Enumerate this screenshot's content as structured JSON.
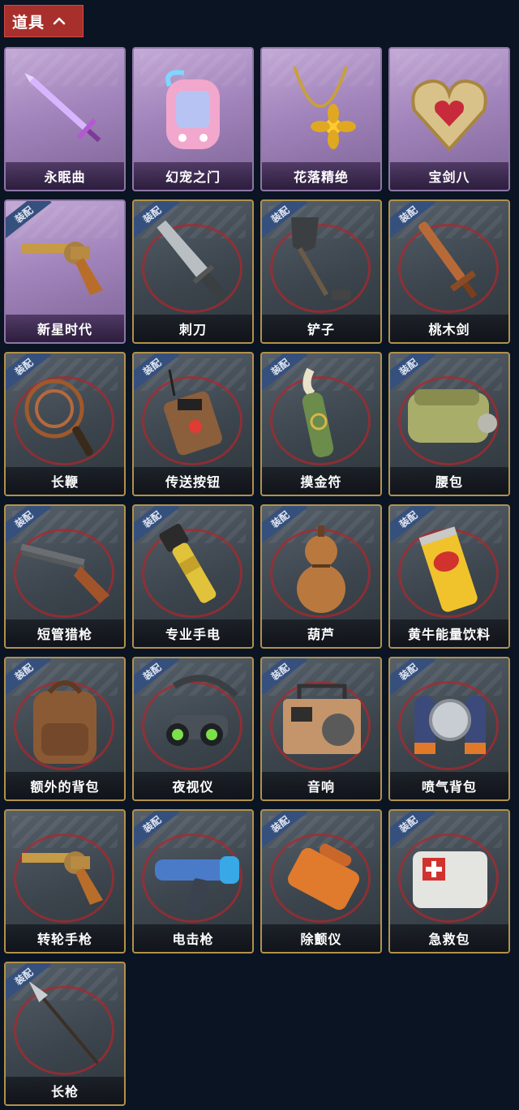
{
  "section": {
    "title": "道具",
    "toggle_icon": "chevron-up-icon"
  },
  "badge_text": "装配",
  "colors": {
    "header": "#a8302c",
    "badge": "#36507e",
    "frame": "#b2914a",
    "ring": "#aa282e",
    "background": "#0b1422"
  },
  "items": [
    {
      "name": "永眠曲",
      "icon": "sword-icon",
      "rarity": "purple",
      "equipped": false
    },
    {
      "name": "幻宠之门",
      "icon": "pet-device-icon",
      "rarity": "purple",
      "equipped": false
    },
    {
      "name": "花落精绝",
      "icon": "flower-necklace-icon",
      "rarity": "purple",
      "equipped": false
    },
    {
      "name": "宝剑八",
      "icon": "heart-amulet-icon",
      "rarity": "purple",
      "equipped": false
    },
    {
      "name": "新星时代",
      "icon": "revolver-icon",
      "rarity": "purple",
      "equipped": true
    },
    {
      "name": "刺刀",
      "icon": "bayonet-icon",
      "rarity": "normal",
      "equipped": true
    },
    {
      "name": "铲子",
      "icon": "shovel-icon",
      "rarity": "normal",
      "equipped": true
    },
    {
      "name": "桃木剑",
      "icon": "wooden-sword-icon",
      "rarity": "normal",
      "equipped": true
    },
    {
      "name": "长鞭",
      "icon": "whip-icon",
      "rarity": "normal",
      "equipped": true
    },
    {
      "name": "传送按钮",
      "icon": "teleport-remote-icon",
      "rarity": "normal",
      "equipped": true
    },
    {
      "name": "摸金符",
      "icon": "talisman-icon",
      "rarity": "normal",
      "equipped": true
    },
    {
      "name": "腰包",
      "icon": "waist-bag-icon",
      "rarity": "normal",
      "equipped": true
    },
    {
      "name": "短管猎枪",
      "icon": "shotgun-icon",
      "rarity": "normal",
      "equipped": true
    },
    {
      "name": "专业手电",
      "icon": "flashlight-icon",
      "rarity": "normal",
      "equipped": true
    },
    {
      "name": "葫芦",
      "icon": "gourd-icon",
      "rarity": "normal",
      "equipped": true
    },
    {
      "name": "黄牛能量饮料",
      "icon": "energy-drink-icon",
      "rarity": "normal",
      "equipped": true
    },
    {
      "name": "额外的背包",
      "icon": "backpack-icon",
      "rarity": "normal",
      "equipped": true
    },
    {
      "name": "夜视仪",
      "icon": "night-vision-icon",
      "rarity": "normal",
      "equipped": true
    },
    {
      "name": "音响",
      "icon": "radio-icon",
      "rarity": "normal",
      "equipped": true
    },
    {
      "name": "喷气背包",
      "icon": "jetpack-icon",
      "rarity": "normal",
      "equipped": true
    },
    {
      "name": "转轮手枪",
      "icon": "revolver-icon",
      "rarity": "normal",
      "equipped": false
    },
    {
      "name": "电击枪",
      "icon": "stun-gun-icon",
      "rarity": "normal",
      "equipped": true
    },
    {
      "name": "除颤仪",
      "icon": "defibrillator-icon",
      "rarity": "normal",
      "equipped": true
    },
    {
      "name": "急救包",
      "icon": "first-aid-kit-icon",
      "rarity": "normal",
      "equipped": true
    },
    {
      "name": "长枪",
      "icon": "spear-icon",
      "rarity": "normal",
      "equipped": true
    }
  ]
}
